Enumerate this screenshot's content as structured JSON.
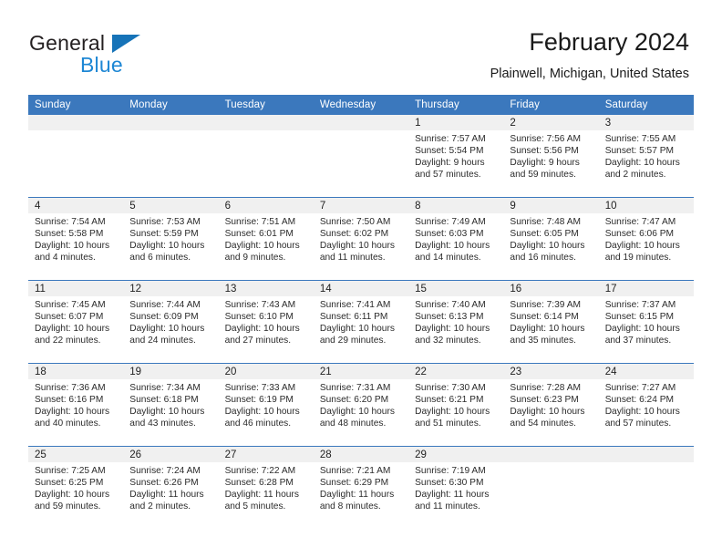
{
  "brand": {
    "name_top": "General",
    "name_bottom": "Blue",
    "triangle_color": "#1673b8",
    "blue_color": "#1e87d4"
  },
  "header": {
    "title": "February 2024",
    "subtitle": "Plainwell, Michigan, United States"
  },
  "theme": {
    "header_row_bg": "#3b78bd",
    "header_row_text": "#ffffff",
    "daynum_band_bg": "#f0f0f0",
    "row_divider": "#3b78bd"
  },
  "calendar": {
    "weekday_headers": [
      "Sunday",
      "Monday",
      "Tuesday",
      "Wednesday",
      "Thursday",
      "Friday",
      "Saturday"
    ],
    "weeks": [
      [
        {
          "day": "",
          "empty": true
        },
        {
          "day": "",
          "empty": true
        },
        {
          "day": "",
          "empty": true
        },
        {
          "day": "",
          "empty": true
        },
        {
          "day": "1",
          "sunrise": "Sunrise: 7:57 AM",
          "sunset": "Sunset: 5:54 PM",
          "daylight1": "Daylight: 9 hours",
          "daylight2": "and 57 minutes."
        },
        {
          "day": "2",
          "sunrise": "Sunrise: 7:56 AM",
          "sunset": "Sunset: 5:56 PM",
          "daylight1": "Daylight: 9 hours",
          "daylight2": "and 59 minutes."
        },
        {
          "day": "3",
          "sunrise": "Sunrise: 7:55 AM",
          "sunset": "Sunset: 5:57 PM",
          "daylight1": "Daylight: 10 hours",
          "daylight2": "and 2 minutes."
        }
      ],
      [
        {
          "day": "4",
          "sunrise": "Sunrise: 7:54 AM",
          "sunset": "Sunset: 5:58 PM",
          "daylight1": "Daylight: 10 hours",
          "daylight2": "and 4 minutes."
        },
        {
          "day": "5",
          "sunrise": "Sunrise: 7:53 AM",
          "sunset": "Sunset: 5:59 PM",
          "daylight1": "Daylight: 10 hours",
          "daylight2": "and 6 minutes."
        },
        {
          "day": "6",
          "sunrise": "Sunrise: 7:51 AM",
          "sunset": "Sunset: 6:01 PM",
          "daylight1": "Daylight: 10 hours",
          "daylight2": "and 9 minutes."
        },
        {
          "day": "7",
          "sunrise": "Sunrise: 7:50 AM",
          "sunset": "Sunset: 6:02 PM",
          "daylight1": "Daylight: 10 hours",
          "daylight2": "and 11 minutes."
        },
        {
          "day": "8",
          "sunrise": "Sunrise: 7:49 AM",
          "sunset": "Sunset: 6:03 PM",
          "daylight1": "Daylight: 10 hours",
          "daylight2": "and 14 minutes."
        },
        {
          "day": "9",
          "sunrise": "Sunrise: 7:48 AM",
          "sunset": "Sunset: 6:05 PM",
          "daylight1": "Daylight: 10 hours",
          "daylight2": "and 16 minutes."
        },
        {
          "day": "10",
          "sunrise": "Sunrise: 7:47 AM",
          "sunset": "Sunset: 6:06 PM",
          "daylight1": "Daylight: 10 hours",
          "daylight2": "and 19 minutes."
        }
      ],
      [
        {
          "day": "11",
          "sunrise": "Sunrise: 7:45 AM",
          "sunset": "Sunset: 6:07 PM",
          "daylight1": "Daylight: 10 hours",
          "daylight2": "and 22 minutes."
        },
        {
          "day": "12",
          "sunrise": "Sunrise: 7:44 AM",
          "sunset": "Sunset: 6:09 PM",
          "daylight1": "Daylight: 10 hours",
          "daylight2": "and 24 minutes."
        },
        {
          "day": "13",
          "sunrise": "Sunrise: 7:43 AM",
          "sunset": "Sunset: 6:10 PM",
          "daylight1": "Daylight: 10 hours",
          "daylight2": "and 27 minutes."
        },
        {
          "day": "14",
          "sunrise": "Sunrise: 7:41 AM",
          "sunset": "Sunset: 6:11 PM",
          "daylight1": "Daylight: 10 hours",
          "daylight2": "and 29 minutes."
        },
        {
          "day": "15",
          "sunrise": "Sunrise: 7:40 AM",
          "sunset": "Sunset: 6:13 PM",
          "daylight1": "Daylight: 10 hours",
          "daylight2": "and 32 minutes."
        },
        {
          "day": "16",
          "sunrise": "Sunrise: 7:39 AM",
          "sunset": "Sunset: 6:14 PM",
          "daylight1": "Daylight: 10 hours",
          "daylight2": "and 35 minutes."
        },
        {
          "day": "17",
          "sunrise": "Sunrise: 7:37 AM",
          "sunset": "Sunset: 6:15 PM",
          "daylight1": "Daylight: 10 hours",
          "daylight2": "and 37 minutes."
        }
      ],
      [
        {
          "day": "18",
          "sunrise": "Sunrise: 7:36 AM",
          "sunset": "Sunset: 6:16 PM",
          "daylight1": "Daylight: 10 hours",
          "daylight2": "and 40 minutes."
        },
        {
          "day": "19",
          "sunrise": "Sunrise: 7:34 AM",
          "sunset": "Sunset: 6:18 PM",
          "daylight1": "Daylight: 10 hours",
          "daylight2": "and 43 minutes."
        },
        {
          "day": "20",
          "sunrise": "Sunrise: 7:33 AM",
          "sunset": "Sunset: 6:19 PM",
          "daylight1": "Daylight: 10 hours",
          "daylight2": "and 46 minutes."
        },
        {
          "day": "21",
          "sunrise": "Sunrise: 7:31 AM",
          "sunset": "Sunset: 6:20 PM",
          "daylight1": "Daylight: 10 hours",
          "daylight2": "and 48 minutes."
        },
        {
          "day": "22",
          "sunrise": "Sunrise: 7:30 AM",
          "sunset": "Sunset: 6:21 PM",
          "daylight1": "Daylight: 10 hours",
          "daylight2": "and 51 minutes."
        },
        {
          "day": "23",
          "sunrise": "Sunrise: 7:28 AM",
          "sunset": "Sunset: 6:23 PM",
          "daylight1": "Daylight: 10 hours",
          "daylight2": "and 54 minutes."
        },
        {
          "day": "24",
          "sunrise": "Sunrise: 7:27 AM",
          "sunset": "Sunset: 6:24 PM",
          "daylight1": "Daylight: 10 hours",
          "daylight2": "and 57 minutes."
        }
      ],
      [
        {
          "day": "25",
          "sunrise": "Sunrise: 7:25 AM",
          "sunset": "Sunset: 6:25 PM",
          "daylight1": "Daylight: 10 hours",
          "daylight2": "and 59 minutes."
        },
        {
          "day": "26",
          "sunrise": "Sunrise: 7:24 AM",
          "sunset": "Sunset: 6:26 PM",
          "daylight1": "Daylight: 11 hours",
          "daylight2": "and 2 minutes."
        },
        {
          "day": "27",
          "sunrise": "Sunrise: 7:22 AM",
          "sunset": "Sunset: 6:28 PM",
          "daylight1": "Daylight: 11 hours",
          "daylight2": "and 5 minutes."
        },
        {
          "day": "28",
          "sunrise": "Sunrise: 7:21 AM",
          "sunset": "Sunset: 6:29 PM",
          "daylight1": "Daylight: 11 hours",
          "daylight2": "and 8 minutes."
        },
        {
          "day": "29",
          "sunrise": "Sunrise: 7:19 AM",
          "sunset": "Sunset: 6:30 PM",
          "daylight1": "Daylight: 11 hours",
          "daylight2": "and 11 minutes."
        },
        {
          "day": "",
          "empty": true
        },
        {
          "day": "",
          "empty": true
        }
      ]
    ]
  }
}
